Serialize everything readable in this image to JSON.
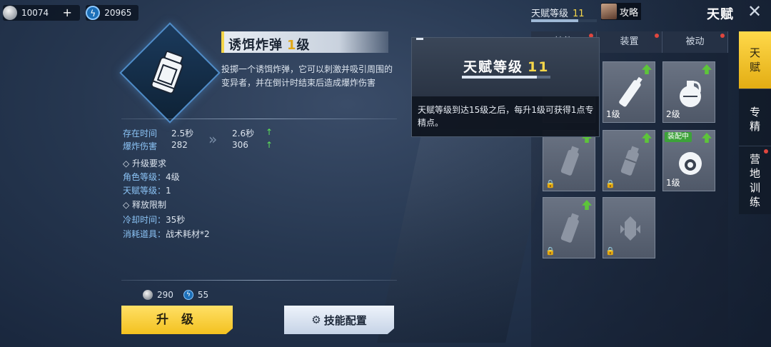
{
  "resources": {
    "silver": "10074",
    "energy": "20965",
    "add_label": "+"
  },
  "top_right": {
    "talent_label": "天赋等级",
    "talent_level": "11",
    "talent_progress": 0.72,
    "guide_label": "攻略",
    "page_title": "天赋",
    "close_glyph": "✕"
  },
  "skill": {
    "name": "诱饵炸弹",
    "level": "1",
    "level_suffix": "级",
    "description": "投掷一个诱饵炸弹，它可以刺激并吸引周围的变异者，并在倒计时结束后造成爆炸伤害",
    "stats": [
      {
        "label": "存在时间",
        "current": "2.5秒",
        "next": "2.6秒",
        "arrow": "↑"
      },
      {
        "label": "爆炸伤害",
        "current": "282",
        "next": "306",
        "arrow": "↑"
      }
    ],
    "chevron": "»",
    "requirements_title": "◇ 升级要求",
    "requirements": [
      {
        "key": "角色等级：",
        "value": "4级"
      },
      {
        "key": "天赋等级：",
        "value": "1"
      }
    ],
    "release_title": "◇ 释放限制",
    "release": [
      {
        "key": "冷却时间：",
        "value": "35秒"
      },
      {
        "key": "消耗道具：",
        "value": "战术耗材*2"
      }
    ],
    "cost_silver": "290",
    "cost_energy": "55"
  },
  "buttons": {
    "upgrade": "升 级",
    "config": "技能配置"
  },
  "sub_tabs": [
    "技能",
    "装置",
    "被动"
  ],
  "grid": [
    {
      "level": "",
      "upgradable": true,
      "locked": false
    },
    {
      "level": "1级",
      "upgradable": true,
      "locked": false
    },
    {
      "level": "2级",
      "upgradable": true,
      "locked": false
    },
    {
      "level": "",
      "upgradable": true,
      "locked": true
    },
    {
      "level": "",
      "upgradable": true,
      "locked": true
    },
    {
      "level": "1级",
      "upgradable": true,
      "locked": false,
      "tag": "装配中"
    },
    {
      "level": "",
      "upgradable": true,
      "locked": true
    },
    {
      "level": "",
      "upgradable": false,
      "locked": true
    }
  ],
  "side_tabs": [
    "天赋",
    "专精",
    "营地训练"
  ],
  "tooltip": {
    "title": "天赋等级",
    "level": "11",
    "progress": 0.85,
    "text": "天赋等级到达15级之后，每升1级可获得1点专精点。"
  },
  "colors": {
    "accent_yellow": "#f5d64a",
    "stat_blue": "#8bc3f5",
    "up_green": "#5de05a"
  }
}
